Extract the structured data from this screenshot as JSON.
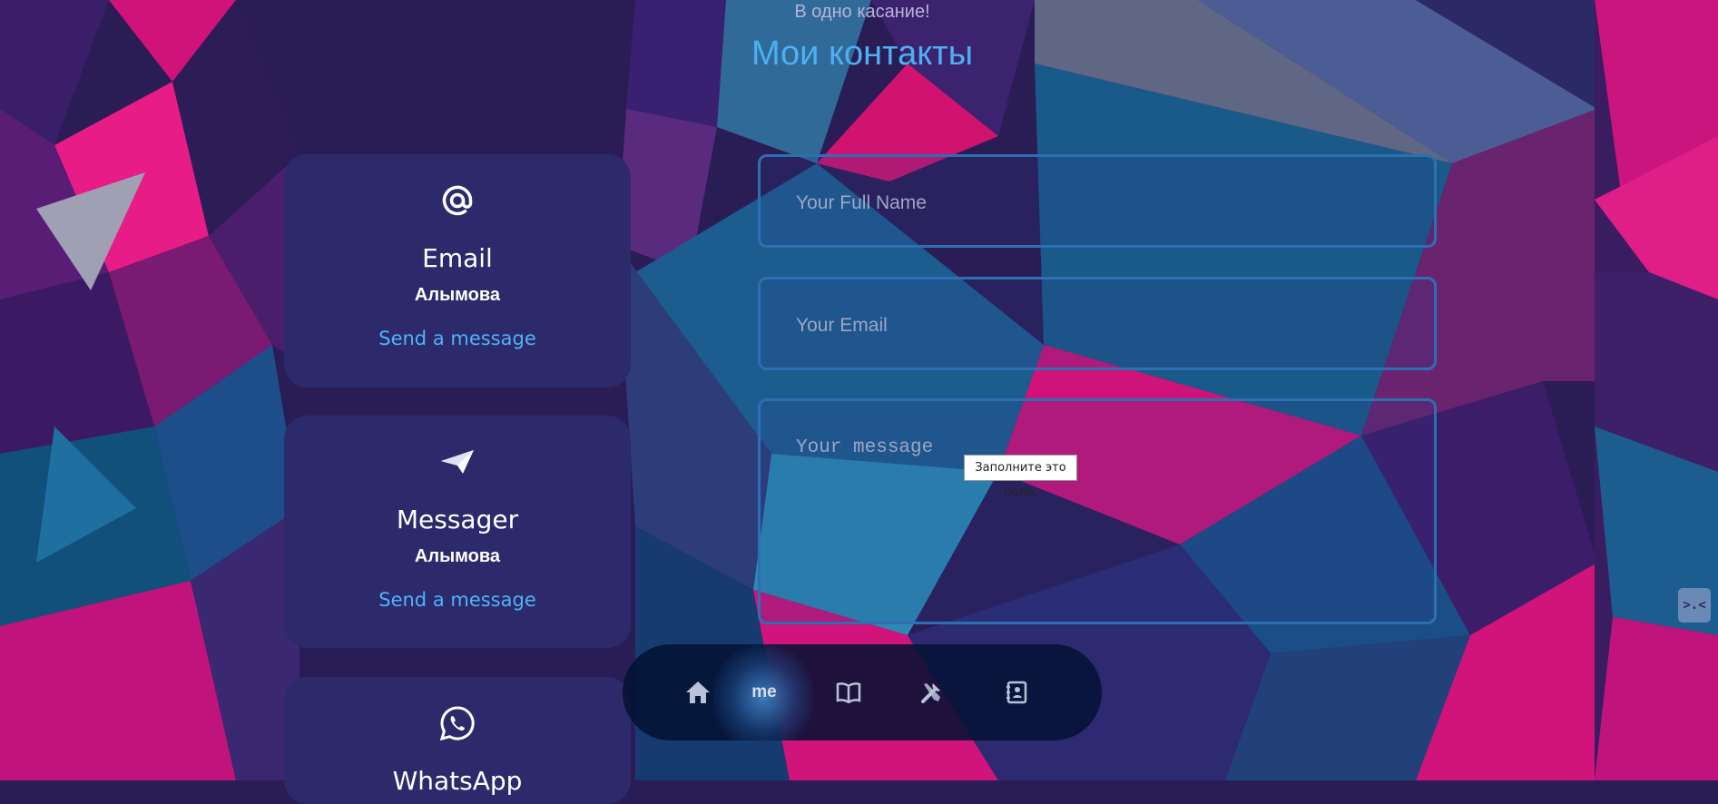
{
  "header": {
    "subtitle": "В одно касание!",
    "title": "Мои контакты"
  },
  "contact_cards": [
    {
      "icon": "at-sign-icon",
      "title": "Email",
      "value": "Алымова",
      "link": "Send a message"
    },
    {
      "icon": "paper-plane-icon",
      "title": "Messager",
      "value": "Алымова",
      "link": "Send a message"
    },
    {
      "icon": "whatsapp-icon",
      "title": "WhatsApp"
    }
  ],
  "form": {
    "name_placeholder": "Your Full Name",
    "email_placeholder": "Your Email",
    "message_placeholder": "Your message"
  },
  "validation_tooltip": "Заполните это поле.",
  "nav": {
    "items": [
      {
        "icon": "home-icon"
      },
      {
        "label": "me"
      },
      {
        "icon": "book-icon"
      },
      {
        "icon": "tools-icon"
      },
      {
        "icon": "contacts-book-icon"
      }
    ],
    "active_index": 1
  },
  "colors": {
    "accent": "#4db0f2",
    "card_bg": "#2d2a6c",
    "field_border": "#2e6fb2",
    "nav_bg": "#051234"
  }
}
